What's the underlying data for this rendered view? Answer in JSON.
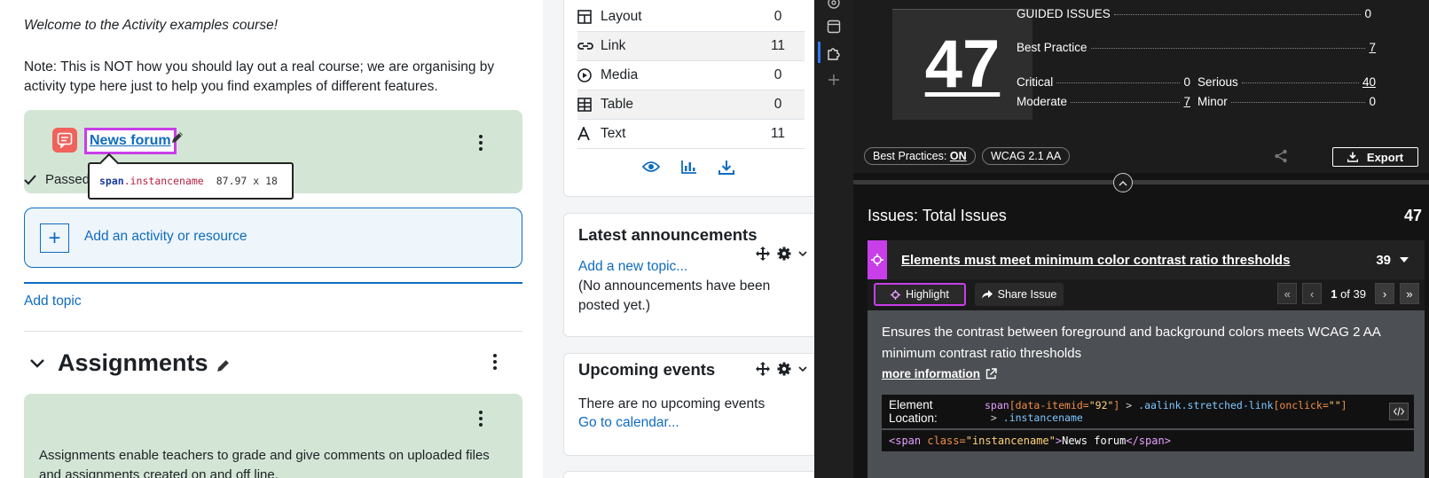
{
  "course": {
    "welcome": "Welcome to the Activity examples course!",
    "note": "Note: This is NOT how you should lay out a real course; we are organising by activity type here just to help you find examples of different features.",
    "forum_link": "News forum",
    "passed_label": "Passed",
    "tooltip": {
      "tag": "span",
      "class": ".instancename",
      "size": "87.97 x 18"
    },
    "add_activity": "Add an activity or resource",
    "add_topic": "Add topic",
    "section_title": "Assignments",
    "assign_desc": "Assignments enable teachers to grade and give comments on uploaded files and assignments created on and off line."
  },
  "stats_block": {
    "rows": [
      {
        "icon": "layout-icon",
        "label": "Layout",
        "value": "0"
      },
      {
        "icon": "link-icon",
        "label": "Link",
        "value": "11"
      },
      {
        "icon": "media-icon",
        "label": "Media",
        "value": "0"
      },
      {
        "icon": "table-icon",
        "label": "Table",
        "value": "0"
      },
      {
        "icon": "text-icon",
        "label": "Text",
        "value": "11"
      }
    ]
  },
  "announcements": {
    "title": "Latest announcements",
    "add_link": "Add a new topic...",
    "empty_text": "(No announcements have been posted yet.)"
  },
  "events": {
    "title": "Upcoming events",
    "empty_text": "There are no upcoming events",
    "calendar_link": "Go to calendar..."
  },
  "panel": {
    "total": "47",
    "guided_label": "GUIDED ISSUES",
    "guided_value": "0",
    "best_practice_label": "Best Practice",
    "best_practice_value": "7",
    "critical_label": "Critical",
    "critical_value": "0",
    "serious_label": "Serious",
    "serious_value": "40",
    "moderate_label": "Moderate",
    "moderate_value": "7",
    "minor_label": "Minor",
    "minor_value": "0",
    "best_practices_pill": "Best Practices:",
    "best_practices_state": "ON",
    "wcag_pill": "WCAG 2.1 AA",
    "export_label": "Export",
    "issues_title": "Issues: Total Issues",
    "issues_total": "47",
    "issue": {
      "name": "Elements must meet minimum color contrast ratio thresholds",
      "count": "39",
      "highlight_label": "Highlight",
      "share_label": "Share Issue",
      "page_current": "1",
      "page_of": "of 39",
      "description": "Ensures the contrast between foreground and background colors meets WCAG 2 AA minimum contrast ratio thresholds",
      "more_info": "more information",
      "location_label": "Element Location:",
      "snippet_text": "News forum "
    }
  },
  "colors": {
    "accent": "#0f6cbf",
    "highlight": "#c83ee8",
    "card_green": "#d3e6d5",
    "forum_icon": "#f0625c"
  }
}
